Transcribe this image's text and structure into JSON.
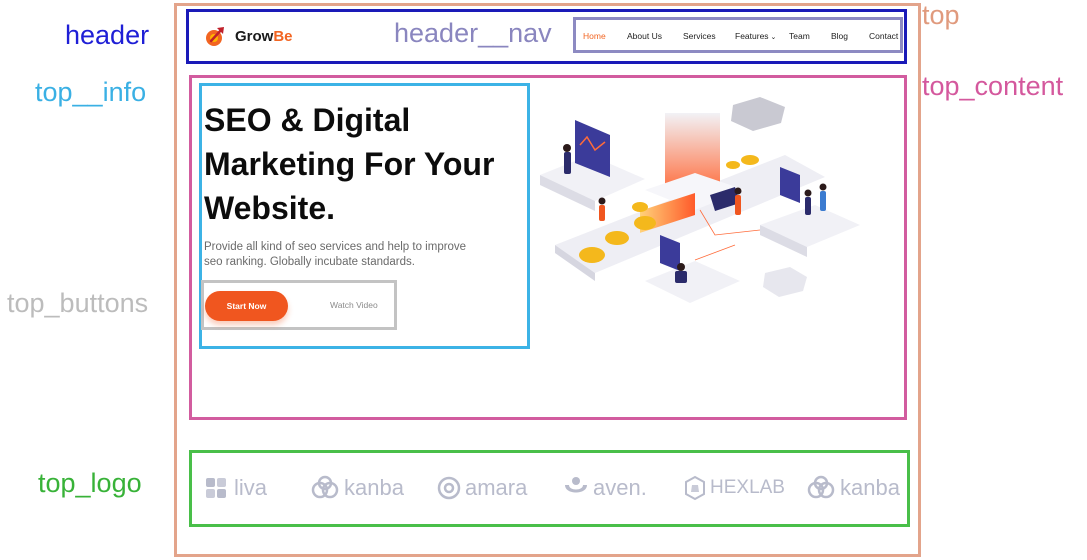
{
  "labels": {
    "header": "header",
    "header_nav": "header__nav",
    "top": "top",
    "top_content": "top_content",
    "top_info": "top__info",
    "top_buttons": "top_buttons",
    "top_logo": "top_logo"
  },
  "brand": {
    "name_main": "Grow",
    "name_accent": "Be"
  },
  "nav": {
    "items": [
      {
        "label": "Home",
        "active": true
      },
      {
        "label": "About Us",
        "active": false
      },
      {
        "label": "Services",
        "active": false
      },
      {
        "label": "Features",
        "active": false
      },
      {
        "label": "Team",
        "active": false
      },
      {
        "label": "Blog",
        "active": false
      },
      {
        "label": "Contact",
        "active": false
      }
    ]
  },
  "hero": {
    "title_line1": "SEO & Digital",
    "title_line2": "Marketing For Your",
    "title_line3": "Website.",
    "subtitle_line1": "Provide all kind of seo services and help to improve",
    "subtitle_line2": "seo ranking. Globally incubate standards.",
    "primary_button": "Start Now",
    "secondary_button": "Watch Video"
  },
  "logos": [
    {
      "name": "liva",
      "icon": "liva-icon"
    },
    {
      "name": "kanba",
      "icon": "kanba-icon"
    },
    {
      "name": "amara",
      "icon": "amara-icon"
    },
    {
      "name": "aven.",
      "icon": "aven-icon"
    },
    {
      "name": "HEXLAB",
      "icon": "hexlab-icon"
    },
    {
      "name": "kanba",
      "icon": "kanba-icon"
    }
  ],
  "colors": {
    "accent": "#f26522",
    "header_box": "#1a1ab8",
    "nav_box": "#8d8ac2",
    "top_box": "#e3a48b",
    "content_box": "#d25c9f",
    "info_box": "#3cb3e6",
    "buttons_box": "#c3c3c3",
    "logo_box": "#49bf49"
  }
}
